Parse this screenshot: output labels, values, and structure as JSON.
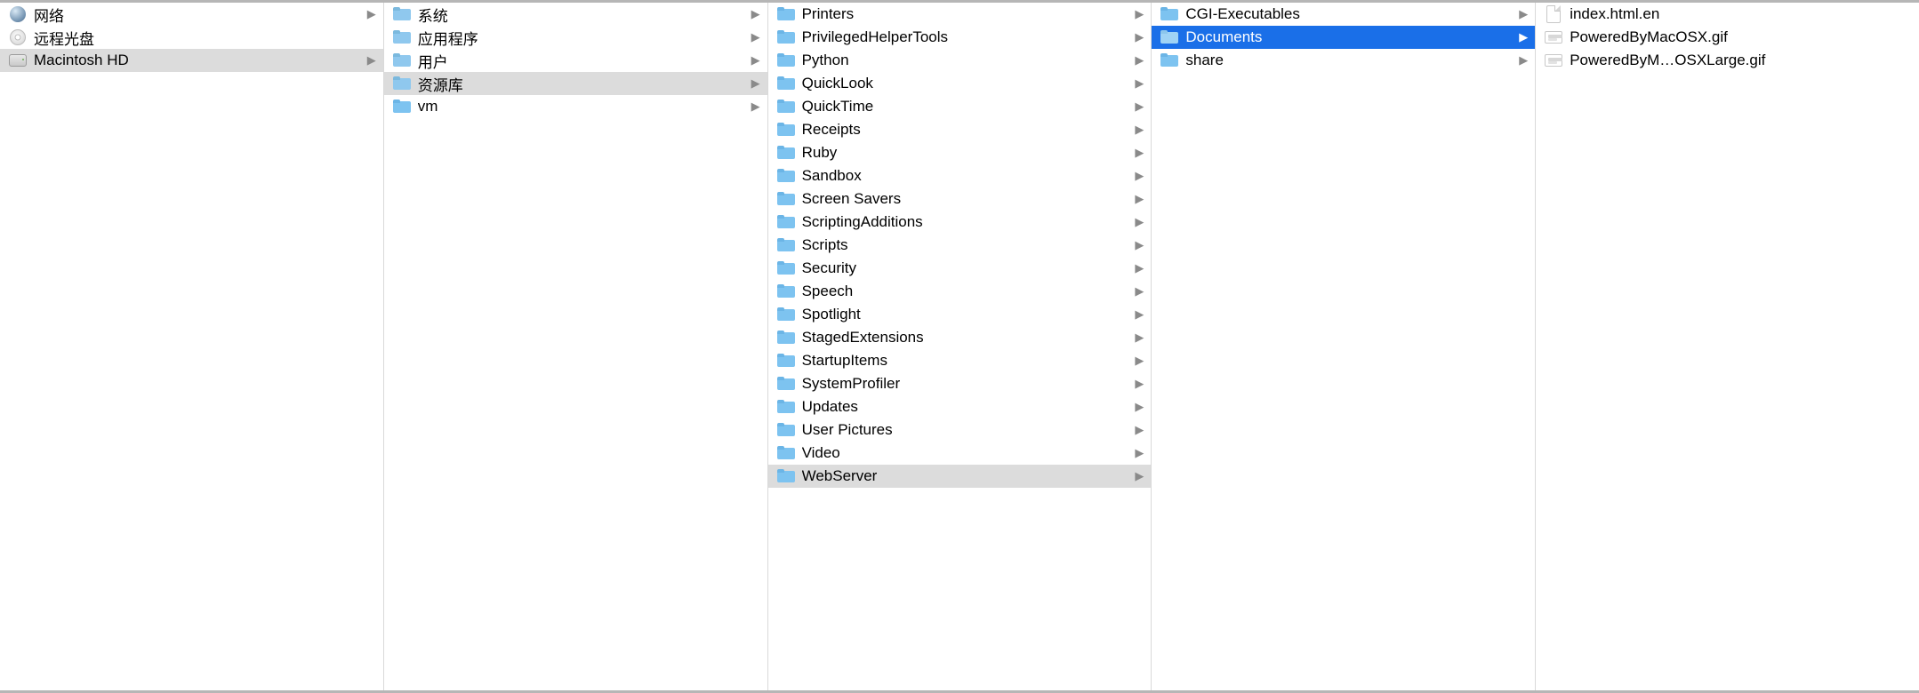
{
  "columns": [
    {
      "id": "devices",
      "items": [
        {
          "label": "网络",
          "icon": "globe",
          "hasChildren": true,
          "state": ""
        },
        {
          "label": "远程光盘",
          "icon": "disc",
          "hasChildren": false,
          "state": ""
        },
        {
          "label": "Macintosh HD",
          "icon": "hdd",
          "hasChildren": true,
          "state": "path-selected"
        }
      ]
    },
    {
      "id": "root",
      "items": [
        {
          "label": "系统",
          "icon": "folder-sys",
          "hasChildren": true,
          "state": ""
        },
        {
          "label": "应用程序",
          "icon": "folder-sys",
          "hasChildren": true,
          "state": ""
        },
        {
          "label": "用户",
          "icon": "folder-sys",
          "hasChildren": true,
          "state": ""
        },
        {
          "label": "资源库",
          "icon": "folder-sys",
          "hasChildren": true,
          "state": "path-selected"
        },
        {
          "label": "vm",
          "icon": "folder",
          "hasChildren": true,
          "state": ""
        }
      ]
    },
    {
      "id": "library",
      "items": [
        {
          "label": "Printers",
          "icon": "folder",
          "hasChildren": true,
          "state": ""
        },
        {
          "label": "PrivilegedHelperTools",
          "icon": "folder",
          "hasChildren": true,
          "state": ""
        },
        {
          "label": "Python",
          "icon": "folder",
          "hasChildren": true,
          "state": ""
        },
        {
          "label": "QuickLook",
          "icon": "folder",
          "hasChildren": true,
          "state": ""
        },
        {
          "label": "QuickTime",
          "icon": "folder",
          "hasChildren": true,
          "state": ""
        },
        {
          "label": "Receipts",
          "icon": "folder",
          "hasChildren": true,
          "state": ""
        },
        {
          "label": "Ruby",
          "icon": "folder",
          "hasChildren": true,
          "state": ""
        },
        {
          "label": "Sandbox",
          "icon": "folder",
          "hasChildren": true,
          "state": ""
        },
        {
          "label": "Screen Savers",
          "icon": "folder",
          "hasChildren": true,
          "state": ""
        },
        {
          "label": "ScriptingAdditions",
          "icon": "folder",
          "hasChildren": true,
          "state": ""
        },
        {
          "label": "Scripts",
          "icon": "folder",
          "hasChildren": true,
          "state": ""
        },
        {
          "label": "Security",
          "icon": "folder",
          "hasChildren": true,
          "state": ""
        },
        {
          "label": "Speech",
          "icon": "folder",
          "hasChildren": true,
          "state": ""
        },
        {
          "label": "Spotlight",
          "icon": "folder",
          "hasChildren": true,
          "state": ""
        },
        {
          "label": "StagedExtensions",
          "icon": "folder",
          "hasChildren": true,
          "state": ""
        },
        {
          "label": "StartupItems",
          "icon": "folder",
          "hasChildren": true,
          "state": ""
        },
        {
          "label": "SystemProfiler",
          "icon": "folder",
          "hasChildren": true,
          "state": ""
        },
        {
          "label": "Updates",
          "icon": "folder",
          "hasChildren": true,
          "state": ""
        },
        {
          "label": "User Pictures",
          "icon": "folder",
          "hasChildren": true,
          "state": ""
        },
        {
          "label": "Video",
          "icon": "folder",
          "hasChildren": true,
          "state": ""
        },
        {
          "label": "WebServer",
          "icon": "folder",
          "hasChildren": true,
          "state": "path-selected"
        }
      ]
    },
    {
      "id": "webserver",
      "items": [
        {
          "label": "CGI-Executables",
          "icon": "folder",
          "hasChildren": true,
          "state": ""
        },
        {
          "label": "Documents",
          "icon": "folder",
          "hasChildren": true,
          "state": "active-selected"
        },
        {
          "label": "share",
          "icon": "folder",
          "hasChildren": true,
          "state": ""
        }
      ]
    },
    {
      "id": "documents",
      "items": [
        {
          "label": "index.html.en",
          "icon": "doc",
          "hasChildren": false,
          "state": ""
        },
        {
          "label": "PoweredByMacOSX.gif",
          "icon": "gif",
          "hasChildren": false,
          "state": ""
        },
        {
          "label": "PoweredByM…OSXLarge.gif",
          "icon": "gif",
          "hasChildren": false,
          "state": ""
        }
      ]
    }
  ]
}
